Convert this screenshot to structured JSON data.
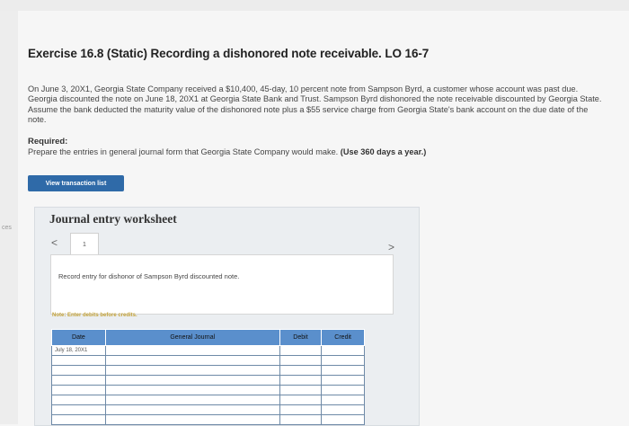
{
  "sidebar": {
    "fragment": "ces"
  },
  "exercise": {
    "title": "Exercise 16.8 (Static) Recording a dishonored note receivable. LO 16-7",
    "problem_text": "On June 3, 20X1, Georgia State Company received a $10,400, 45-day, 10 percent note from Sampson Byrd, a customer whose account was past due. Georgia discounted the note on June 18, 20X1 at Georgia State Bank and Trust. Sampson Byrd dishonored the note receivable discounted by Georgia State. Assume the bank deducted the maturity value of the dishonored note plus a $55 service charge from Georgia State's bank account on the due date of the note.",
    "required_heading": "Required:",
    "required_text": "Prepare the entries in general journal form that Georgia State Company would make.",
    "required_emphasis": "(Use 360 days a year.)"
  },
  "toolbar": {
    "view_transactions_label": "View transaction list"
  },
  "worksheet": {
    "title": "Journal entry worksheet",
    "prev_symbol": "<",
    "next_symbol": ">",
    "page_number": "1",
    "instruction": "Record entry for dishonor of Sampson Byrd discounted note.",
    "note": "Note: Enter debits before credits.",
    "columns": [
      "Date",
      "General Journal",
      "Debit",
      "Credit"
    ],
    "rows": [
      [
        "July 18, 20X1",
        "",
        "",
        ""
      ],
      [
        "",
        "",
        "",
        ""
      ],
      [
        "",
        "",
        "",
        ""
      ],
      [
        "",
        "",
        "",
        ""
      ],
      [
        "",
        "",
        "",
        ""
      ],
      [
        "",
        "",
        "",
        ""
      ],
      [
        "",
        "",
        "",
        ""
      ],
      [
        "",
        "",
        "",
        ""
      ]
    ]
  }
}
